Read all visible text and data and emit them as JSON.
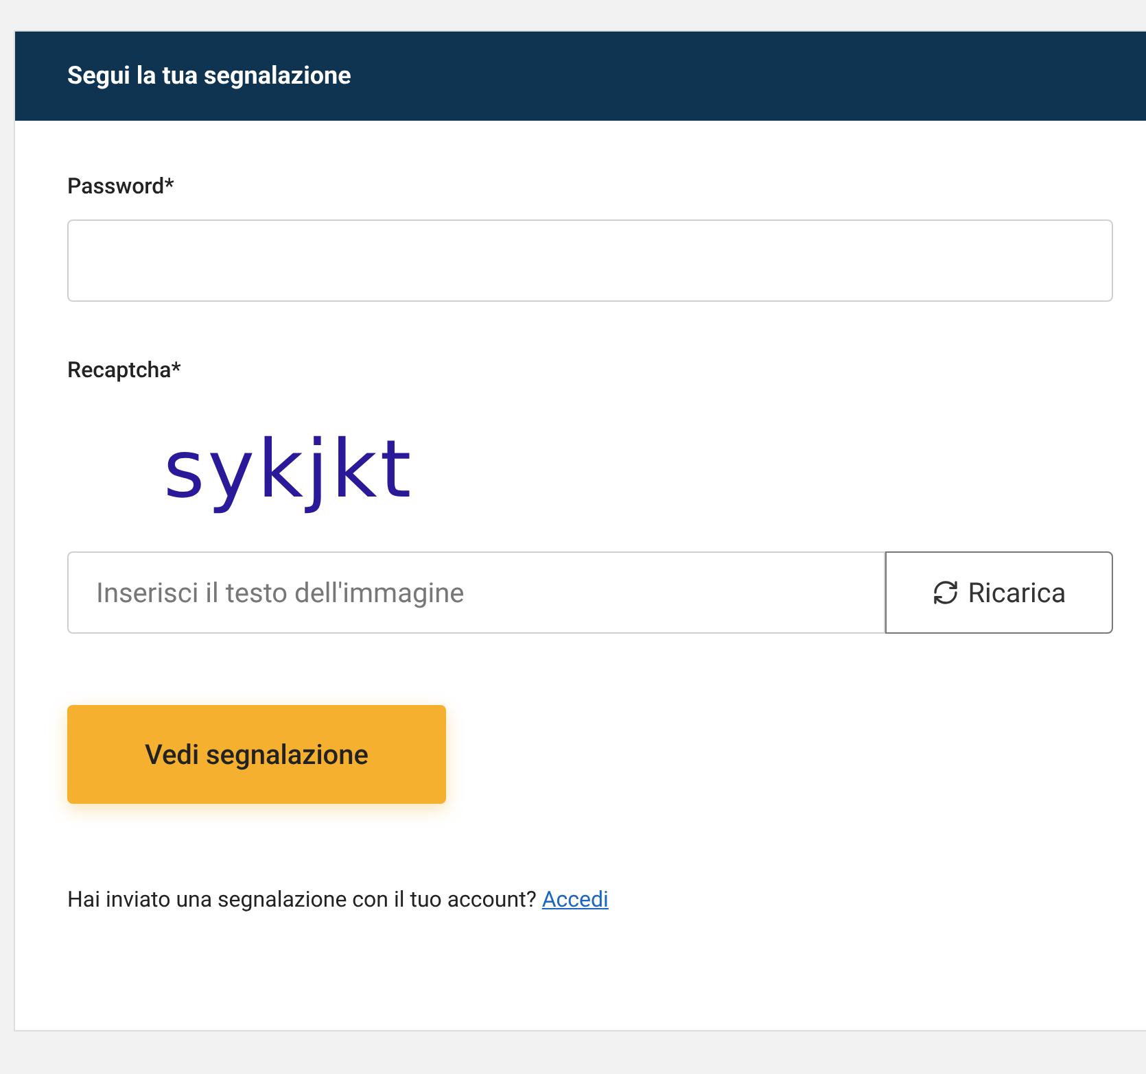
{
  "panel": {
    "title": "Segui la tua segnalazione"
  },
  "password": {
    "label": "Password*"
  },
  "recaptcha": {
    "label": "Recaptcha*",
    "captcha_text": "sykjkt",
    "placeholder": "Inserisci il testo dell'immagine",
    "reload_button": "Ricarica"
  },
  "submit_button": "Vedi segnalazione",
  "footer": {
    "text": "Hai inviato una segnalazione con il tuo account?",
    "link": "Accedi"
  }
}
